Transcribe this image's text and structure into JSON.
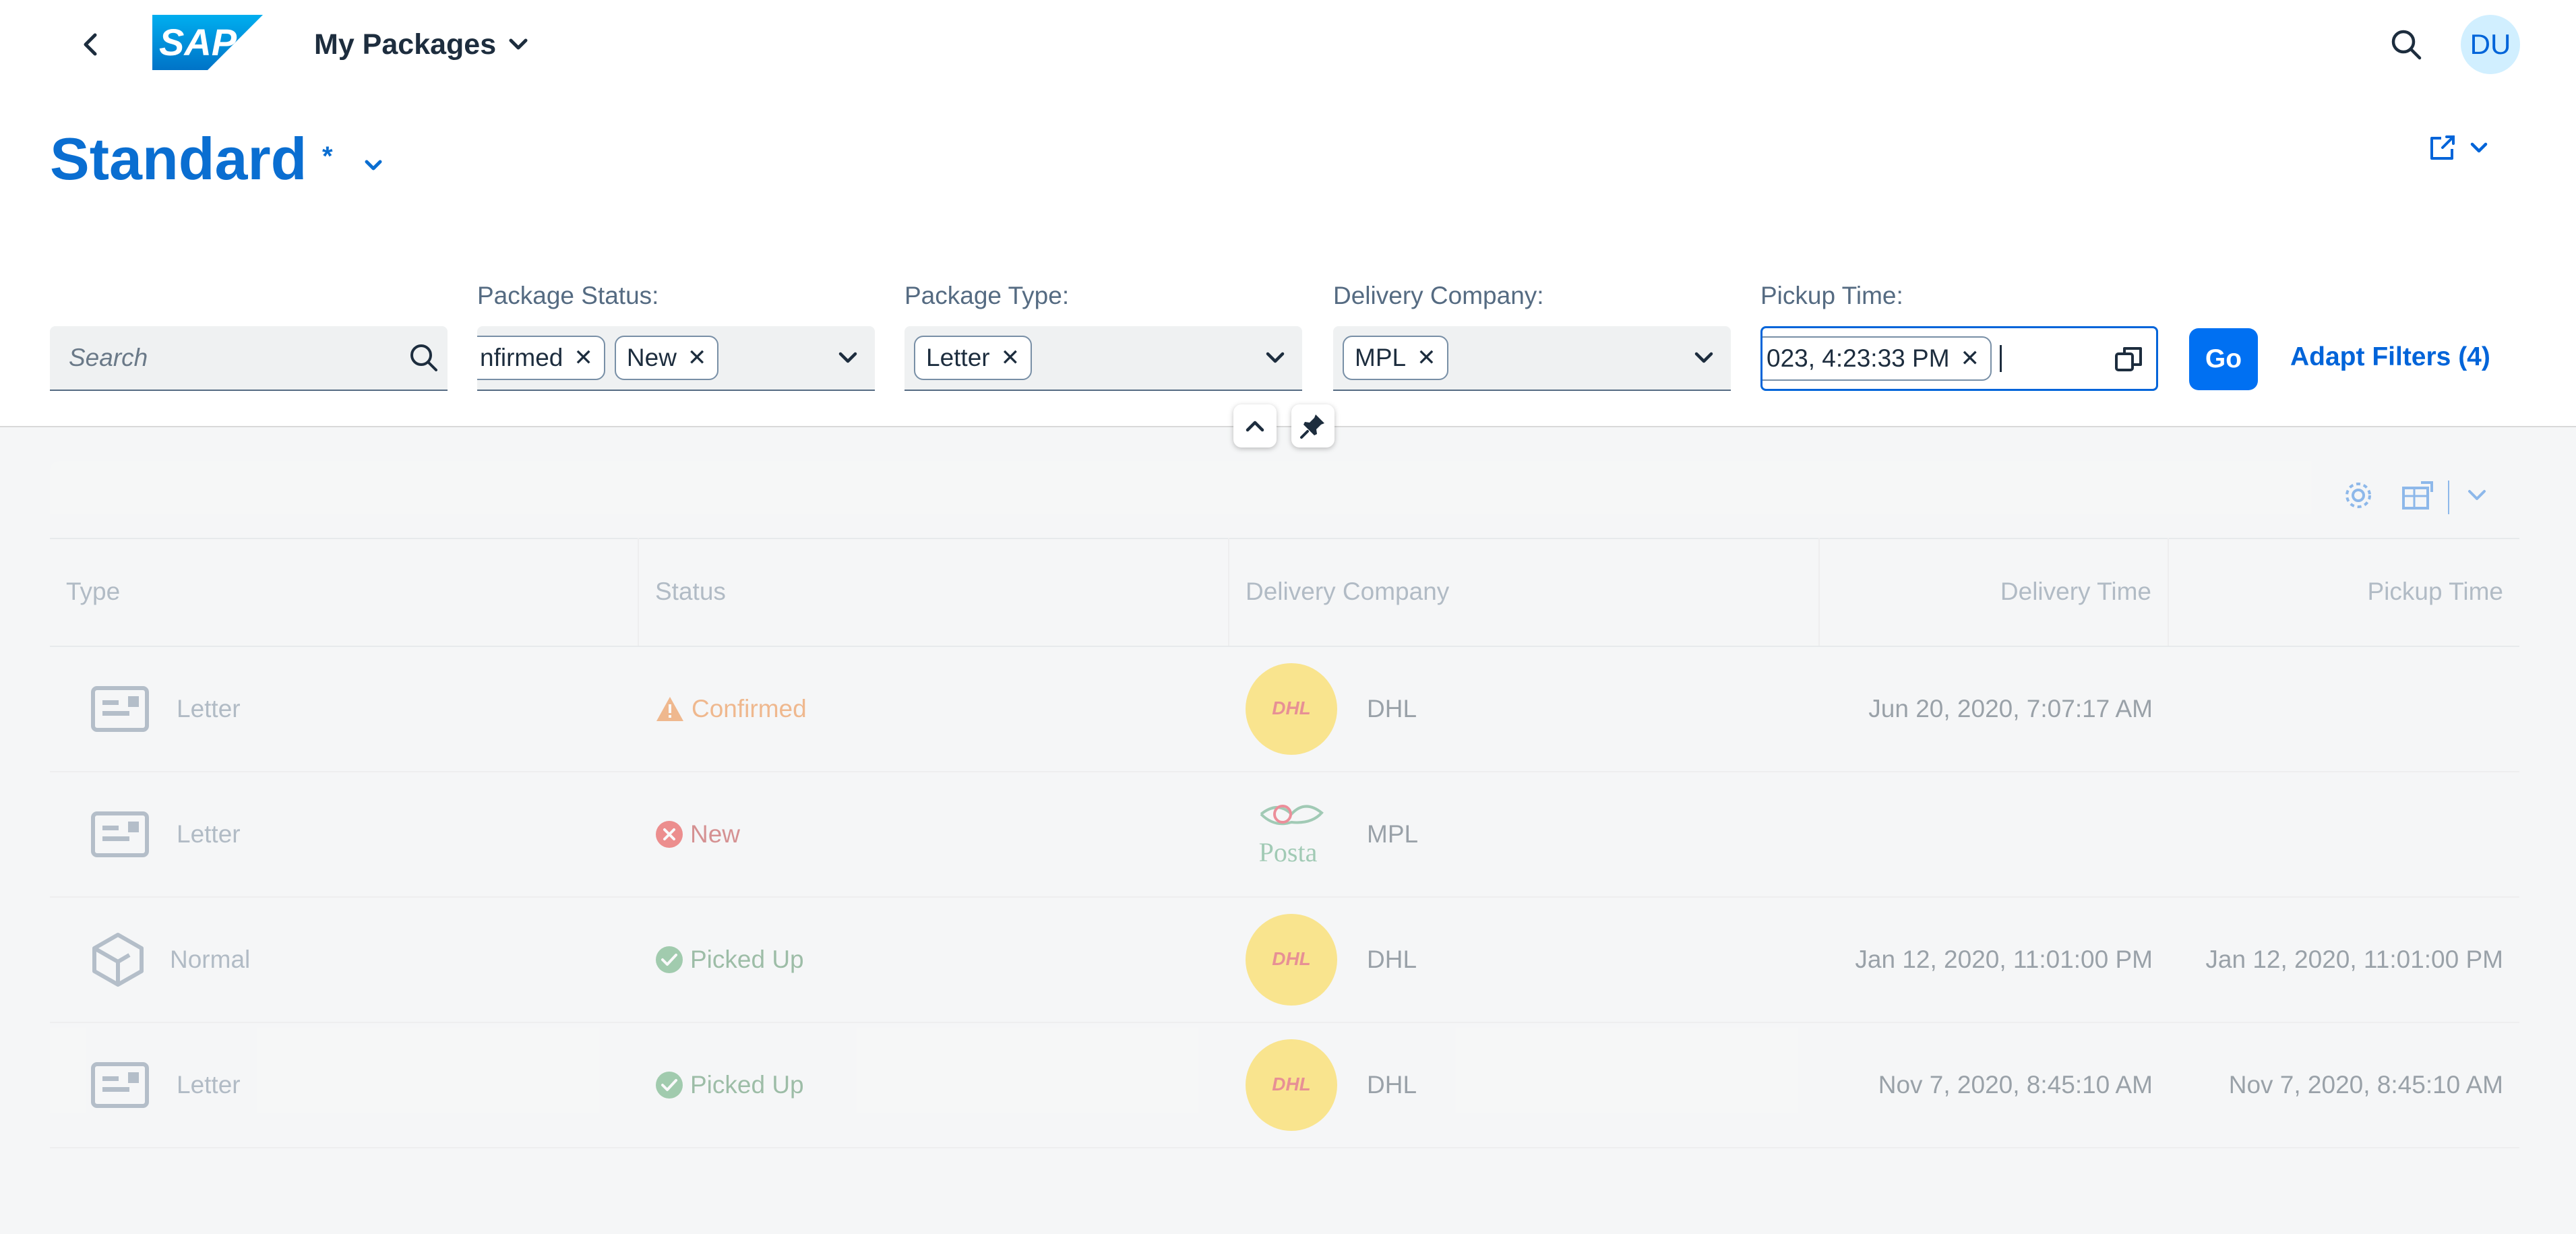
{
  "shell": {
    "app_title": "My Packages",
    "avatar_initials": "DU",
    "logo_text": "SAP"
  },
  "header": {
    "variant_title": "Standard",
    "variant_modified_marker": "*"
  },
  "filters": {
    "search_placeholder": "Search",
    "package_status": {
      "label": "Package Status:",
      "tokens": [
        "nfirmed",
        "New"
      ]
    },
    "package_type": {
      "label": "Package Type:",
      "tokens": [
        "Letter"
      ]
    },
    "delivery_company": {
      "label": "Delivery Company:",
      "tokens": [
        "MPL"
      ]
    },
    "pickup_time": {
      "label": "Pickup Time:",
      "tokens": [
        "023, 4:23:33 PM"
      ]
    },
    "go_label": "Go",
    "adapt_filters_label": "Adapt Filters (4)"
  },
  "table": {
    "columns": [
      "Type",
      "Status",
      "Delivery Company",
      "Delivery Time",
      "Pickup Time"
    ],
    "rows": [
      {
        "type": "Letter",
        "type_icon": "letter-icon",
        "status": "Confirmed",
        "status_kind": "warning",
        "company": "DHL",
        "delivery_time": "Jun 20, 2020, 7:07:17 AM",
        "pickup_time": ""
      },
      {
        "type": "Letter",
        "type_icon": "letter-icon",
        "status": "New",
        "status_kind": "error",
        "company": "MPL",
        "delivery_time": "",
        "pickup_time": ""
      },
      {
        "type": "Normal",
        "type_icon": "package-icon",
        "status": "Picked Up",
        "status_kind": "success",
        "company": "DHL",
        "delivery_time": "Jan 12, 2020, 11:01:00 PM",
        "pickup_time": "Jan 12, 2020, 11:01:00 PM"
      },
      {
        "type": "Letter",
        "type_icon": "letter-icon",
        "status": "Picked Up",
        "status_kind": "success",
        "company": "DHL",
        "delivery_time": "Nov 7, 2020, 8:45:10 AM",
        "pickup_time": "Nov 7, 2020, 8:45:10 AM"
      }
    ]
  },
  "logos": {
    "dhl_text": "DHL",
    "posta_text": "Posta"
  },
  "colors": {
    "brand": "#0070f2",
    "title": "#0a6ed1",
    "warning": "#e76500",
    "error": "#aa0808",
    "success": "#256f3a",
    "dhl_yellow": "#ffcc00",
    "dhl_red": "#d40511"
  }
}
